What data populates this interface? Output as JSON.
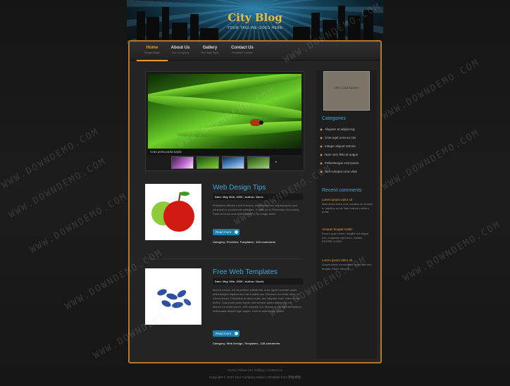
{
  "header": {
    "title": "City Blog",
    "subtitle": "YOUR TAGLINE GOES HERE"
  },
  "nav": [
    {
      "label": "Home",
      "sub": "Ginger Blight"
    },
    {
      "label": "About Us",
      "sub": "Our Company"
    },
    {
      "label": "Gallery",
      "sub": "Red Nail Style"
    },
    {
      "label": "Contact Us",
      "sub": "Possible Guests"
    }
  ],
  "slider": {
    "caption": "Cras porta porta turpis"
  },
  "posts": [
    {
      "title": "Web Design Tips",
      "meta_date": "Date: May 20th, 2009",
      "meta_author": "Author: Steve",
      "text": "Phasellus ultricies a tell et luctus. Vestibulum nec adipiscing for your personal or commercial websites. Credits go to PhotoVaco for photos, Flash in brush and slideViewerPro for image slider.",
      "read_more": "Read more",
      "category": "Category: Freebies, Templates",
      "comments": "204 comments"
    },
    {
      "title": "Free Web Templates",
      "meta_date": "Date: May 19th, 2009",
      "meta_author": "Author: David",
      "text": "Mauris cursus, est at pretium sollicitudin, nunc ligula molestie quam, pellentesque dapibus leo nisi sodales dui. Vivamus orci nulla diam, et rutrum lectus. Phasellus ac dolor nulla, nec aliquam nunc. Nam et orci lectus. Cras porta porta turpis, sed semper quam adipiscing vel. Mauris vel amet ipsum, velit molestie leo. Mauris et elit eget fermentum malesuada aliquet eget augue. Duis et amet lorem ipsum.",
      "read_more": "Read more",
      "category": "Category: Web Design, Templates",
      "comments": "128 comments"
    }
  ],
  "sidebar": {
    "banner": "180 x 150 banner",
    "categories_title": "Categories",
    "categories": [
      "Aliquam at adipiscing",
      "Cras eget urna eu nisi",
      "Integer aliquet tortorie",
      "Nam sem felis at augue",
      "Pellentesque erat ipsum",
      "Sed volutpat urna vitae"
    ],
    "recent_title": "Recent comments",
    "recent": [
      {
        "title": "Lorem ipsum dolor sit",
        "body": "Maecenas tellus erat, sodales ac semper a, dapibus ac sit. Nam rutrum pretium porta."
      },
      {
        "title": "Aenean feugiat mattis",
        "body": "Donec quam enim, fringilla vel aliquet nec, vulputate eget arcu. Nullam ENTREL A ZEN."
      },
      {
        "title": "Lorem ipsum dolor sit",
        "body": "Suspendisse consectetur venenatis nec feugiat. Etiam lobortis."
      }
    ]
  },
  "footer": {
    "links": "Home | About Us | Gallery | Contact Us",
    "copyright": "Copyright © 2010 Your Company Name | Template from 网站模板"
  },
  "watermark": "WWW.DOWNDEMO.COM"
}
